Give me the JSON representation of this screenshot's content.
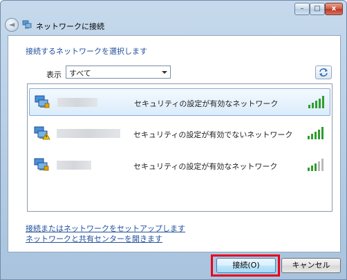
{
  "window": {
    "title": "ネットワークに接続",
    "caption_buttons": {
      "minimize": "–",
      "maximize": "□",
      "close": "x"
    }
  },
  "nav": {
    "back_icon": "back-arrow-icon",
    "back_glyph": "◄"
  },
  "main": {
    "instruction": "接続するネットワークを選択します",
    "show_label": "表示",
    "filter_value": "すべて",
    "refresh_icon": "refresh-icon"
  },
  "networks": [
    {
      "status": "セキュリティの設定が有効なネットワーク",
      "secured": true,
      "signal_bars": 5,
      "selected": true
    },
    {
      "status": "セキュリティの設定が有効でないネットワーク",
      "secured": false,
      "signal_bars": 5,
      "selected": false
    },
    {
      "status": "セキュリティの設定が有効なネットワーク",
      "secured": true,
      "signal_bars": 3,
      "selected": false
    }
  ],
  "links": {
    "setup": "接続またはネットワークをセットアップします",
    "network_center": "ネットワークと共有センターを開きます"
  },
  "buttons": {
    "connect": "接続(O)",
    "cancel": "キャンセル"
  },
  "colors": {
    "link": "#1f4e9c",
    "highlight": "#e8001c",
    "signal_on": "#2e9e2e",
    "signal_off": "#b9b9b9"
  }
}
